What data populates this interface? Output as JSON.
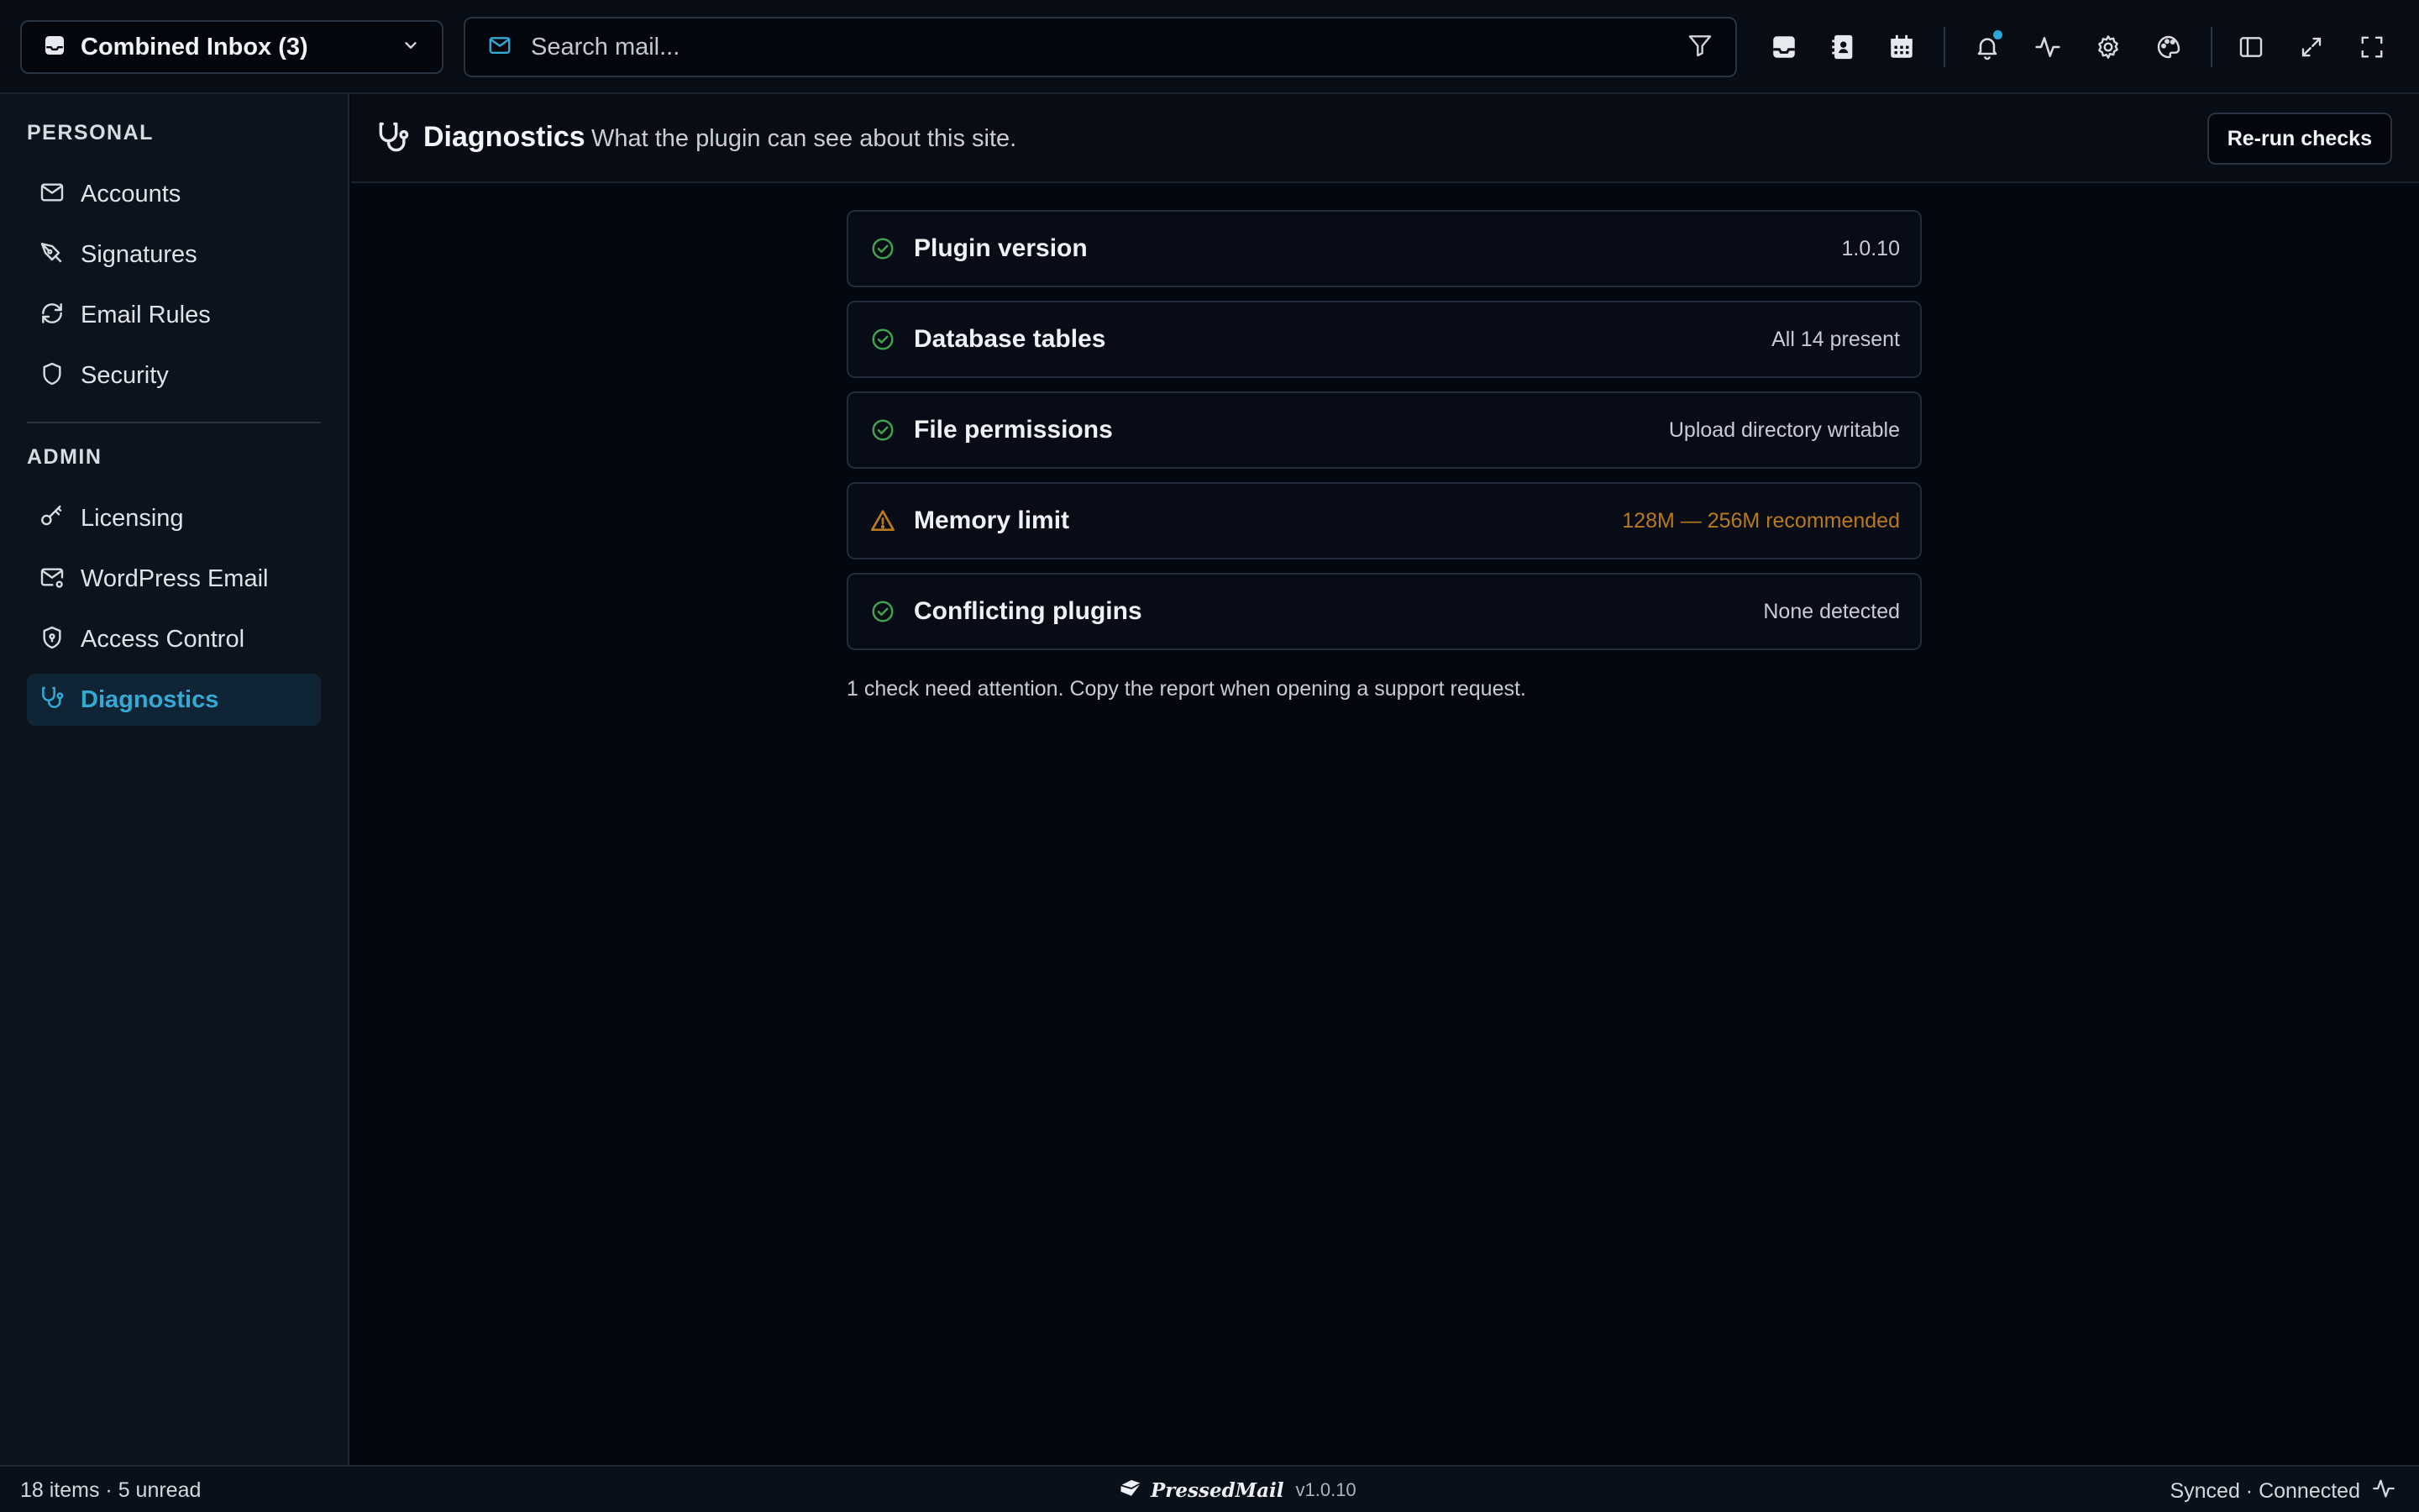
{
  "topbar": {
    "inbox_label": "Combined Inbox (3)",
    "search_placeholder": "Search mail...",
    "icons": [
      "inbox-icon",
      "contacts-icon",
      "calendar-icon",
      "bell-icon",
      "activity-icon",
      "gear-icon",
      "palette-icon",
      "sidebar-toggle-icon",
      "expand-icon",
      "fullscreen-icon"
    ],
    "notification_dot_color": "#2aa7d6"
  },
  "sidebar": {
    "personal_title": "PERSONAL",
    "admin_title": "ADMIN",
    "personal_items": [
      {
        "label": "Accounts",
        "icon": "mail-icon"
      },
      {
        "label": "Signatures",
        "icon": "pen-nib-icon"
      },
      {
        "label": "Email Rules",
        "icon": "refresh-icon"
      },
      {
        "label": "Security",
        "icon": "shield-icon"
      }
    ],
    "admin_items": [
      {
        "label": "Licensing",
        "icon": "key-icon"
      },
      {
        "label": "WordPress Email",
        "icon": "mail-settings-icon"
      },
      {
        "label": "Access Control",
        "icon": "shield-lock-icon"
      },
      {
        "label": "Diagnostics",
        "icon": "stethoscope-icon",
        "active": true
      }
    ]
  },
  "header": {
    "title": "Diagnostics",
    "subtitle": "What the plugin can see about this site.",
    "rerun_label": "Re-run checks"
  },
  "checks": [
    {
      "name": "Plugin version",
      "value": "1.0.10",
      "status": "ok"
    },
    {
      "name": "Database tables",
      "value": "All 14 present",
      "status": "ok"
    },
    {
      "name": "File permissions",
      "value": "Upload directory writable",
      "status": "ok"
    },
    {
      "name": "Memory limit",
      "value": "128M — 256M recommended",
      "status": "warning"
    },
    {
      "name": "Conflicting plugins",
      "value": "None detected",
      "status": "ok"
    }
  ],
  "footnote": "1 check need attention. Copy the report when opening a support request.",
  "statusbar": {
    "left": "18 items · 5 unread",
    "brand": "PressedMail",
    "version": "v1.0.10",
    "right": "Synced · Connected"
  },
  "colors": {
    "accent": "#33a9d4",
    "ok": "#3fa34d",
    "warning": "#b9791d"
  }
}
